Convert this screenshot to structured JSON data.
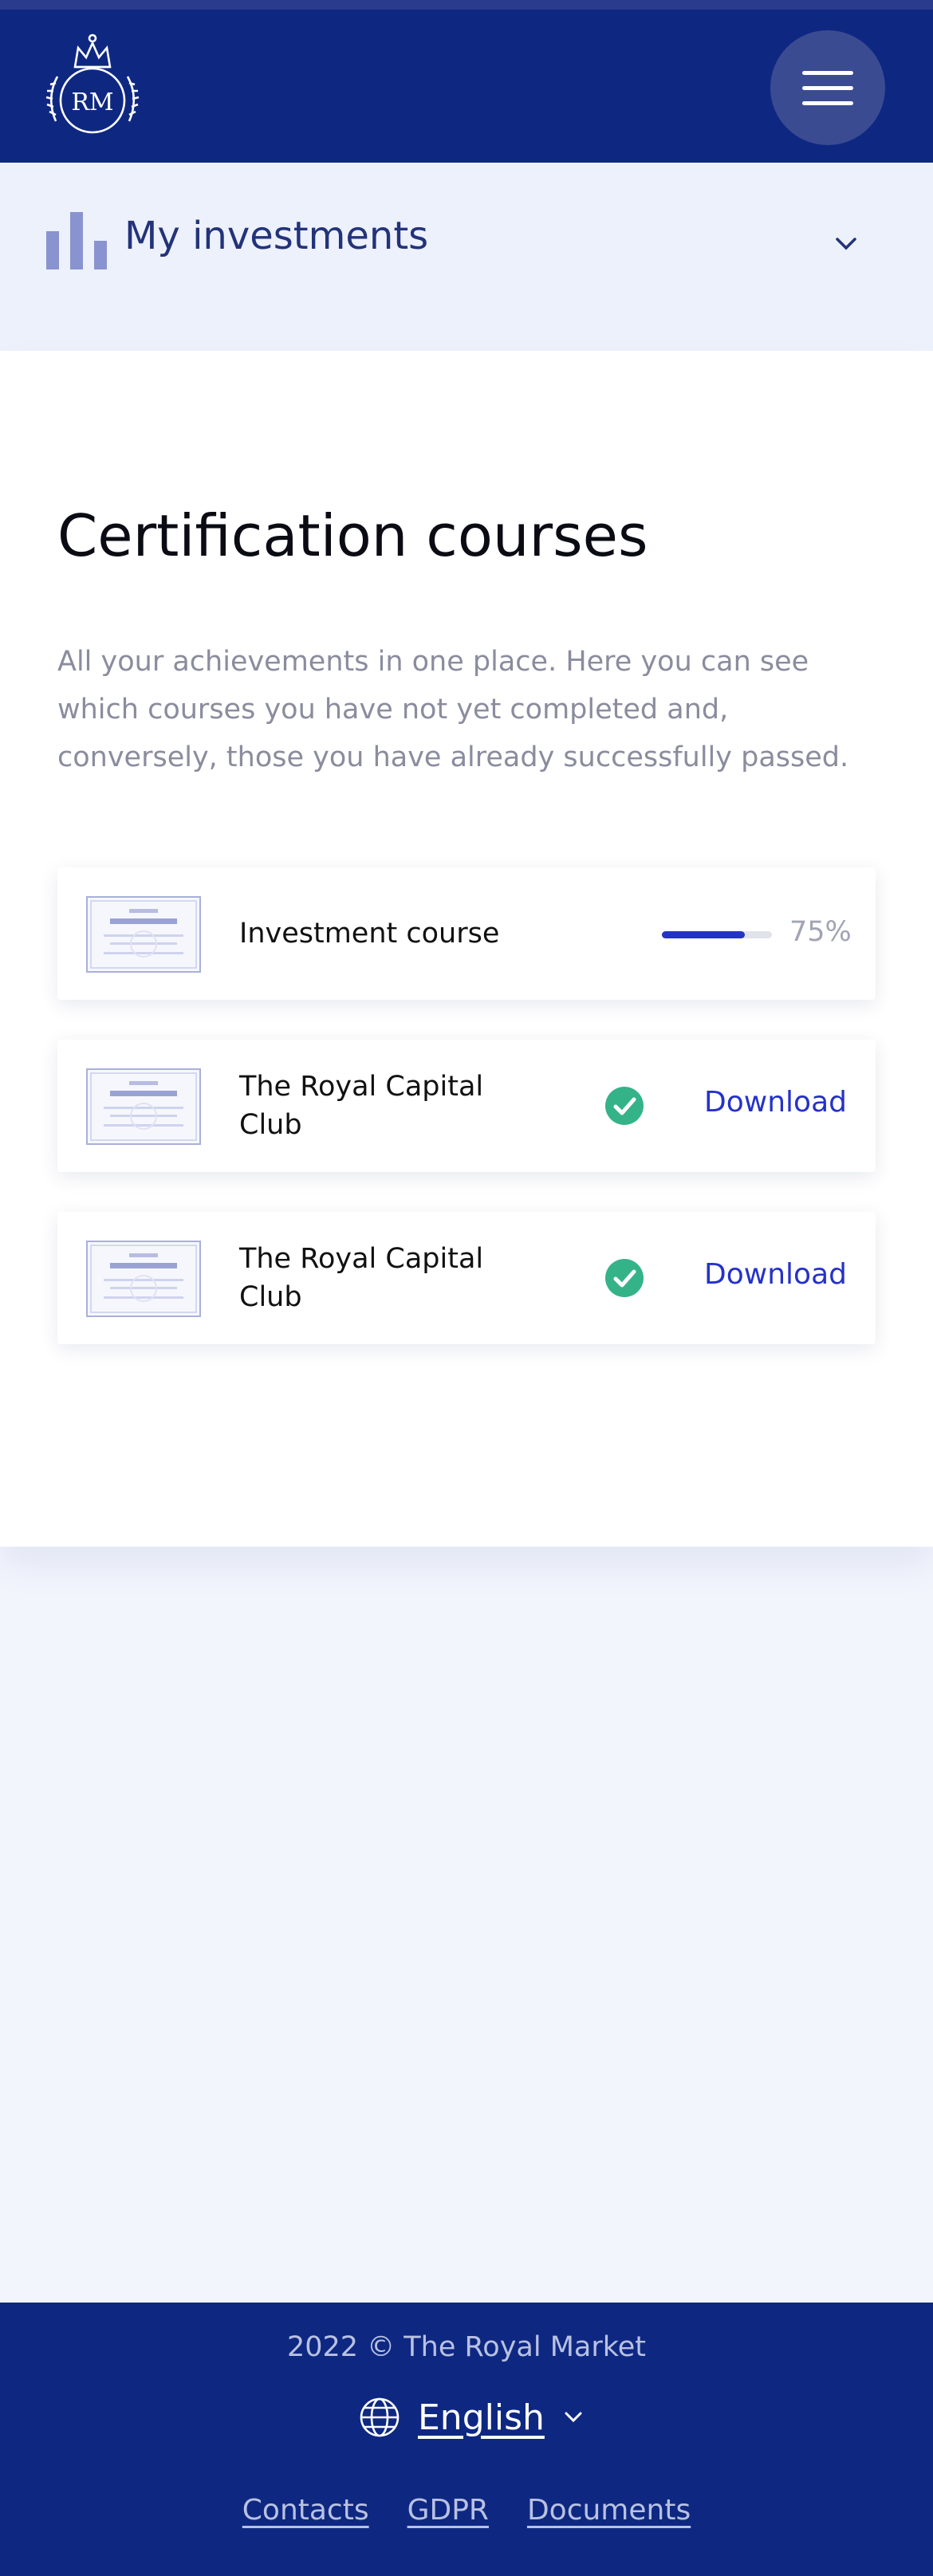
{
  "header": {
    "logo_text": "RM",
    "menu_icon": "hamburger-icon"
  },
  "investments": {
    "icon": "bar-chart-icon",
    "label": "My investments",
    "toggle_icon": "chevron-down-icon"
  },
  "main": {
    "title": "Certification courses",
    "description": "All your achievements in one place. Here you can see which courses you have not yet completed and, conversely, those you have already successfully passed.",
    "courses": [
      {
        "name": "Investment course",
        "progress": 0.75,
        "progress_label": "75%",
        "thumbnail": "certificate-thumbnail"
      },
      {
        "name": "The Royal Capital Club",
        "status_icon": "check-circle-icon",
        "action": "Download",
        "thumbnail": "certificate-thumbnail"
      },
      {
        "name": "The Royal Capital Club",
        "status_icon": "check-circle-icon",
        "action": "Download",
        "thumbnail": "certificate-thumbnail"
      }
    ]
  },
  "footer": {
    "copyright": "2022 © The Royal Market",
    "language": "English",
    "language_icon": "globe-icon",
    "links": [
      "Contacts",
      "GDPR",
      "Documents"
    ]
  },
  "colors": {
    "header_bg": "#0e2882",
    "accent": "#2532c8",
    "success": "#35b388",
    "page_bg": "#f3f5fd"
  }
}
